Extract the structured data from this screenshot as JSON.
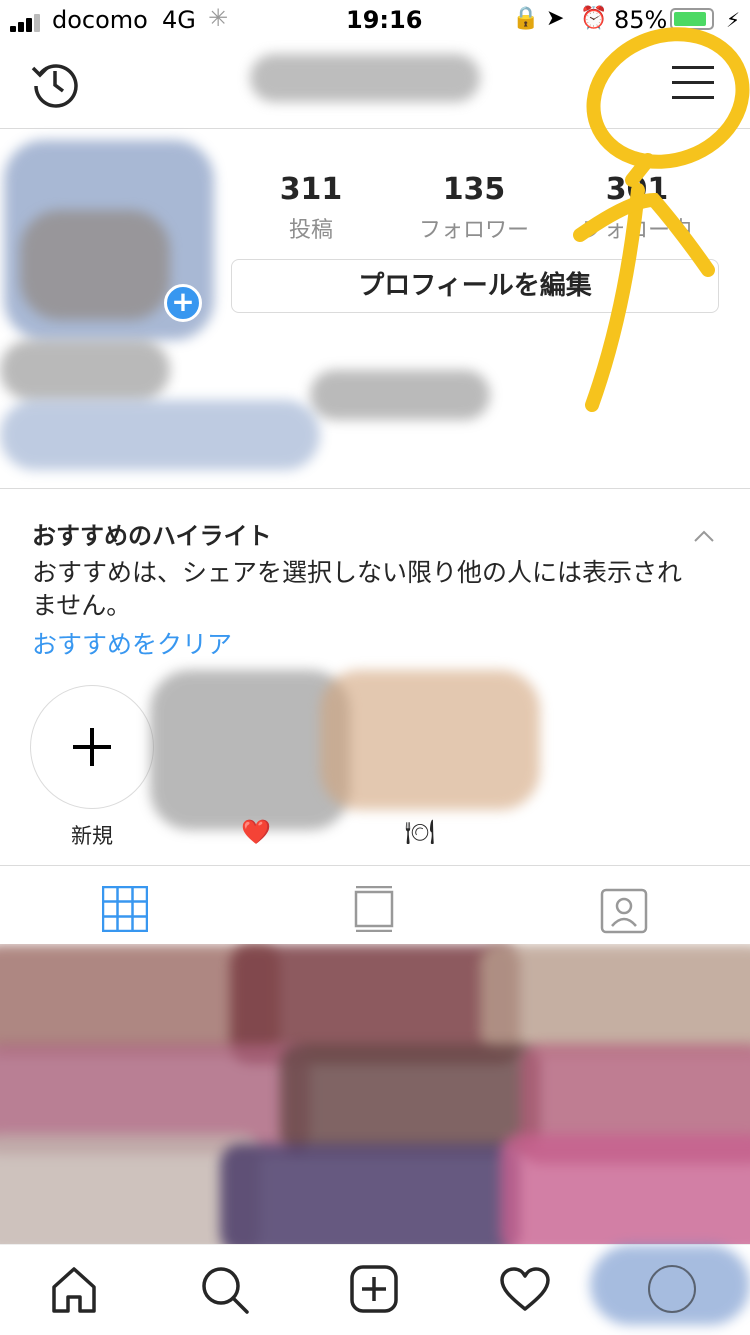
{
  "status_bar": {
    "carrier": "docomo",
    "network": "4G",
    "time": "19:16",
    "battery": "85%",
    "battery_level": 0.85
  },
  "profile": {
    "stats": [
      {
        "value": "311",
        "label": "投稿"
      },
      {
        "value": "135",
        "label": "フォロワー"
      },
      {
        "value": "301",
        "label": "フォロー中"
      }
    ],
    "edit_label": "プロフィールを編集"
  },
  "highlights_section": {
    "title": "おすすめのハイライト",
    "description": "おすすめは、シェアを選択しない限り他の人には表示されません。",
    "clear_link": "おすすめをクリア",
    "items": [
      {
        "label": "新規"
      },
      {
        "label": "❤️"
      },
      {
        "label": "🍽"
      }
    ]
  },
  "colors": {
    "link": "#3897f0",
    "annotation": "#f6c31d",
    "add_badge": "#3897f0",
    "grid_tab_active": "#3897f0"
  },
  "icons": [
    "history-icon",
    "menu-icon",
    "grid-icon",
    "feed-icon",
    "tagged-icon",
    "home-icon",
    "search-icon",
    "add-post-icon",
    "heart-icon",
    "profile-icon"
  ]
}
